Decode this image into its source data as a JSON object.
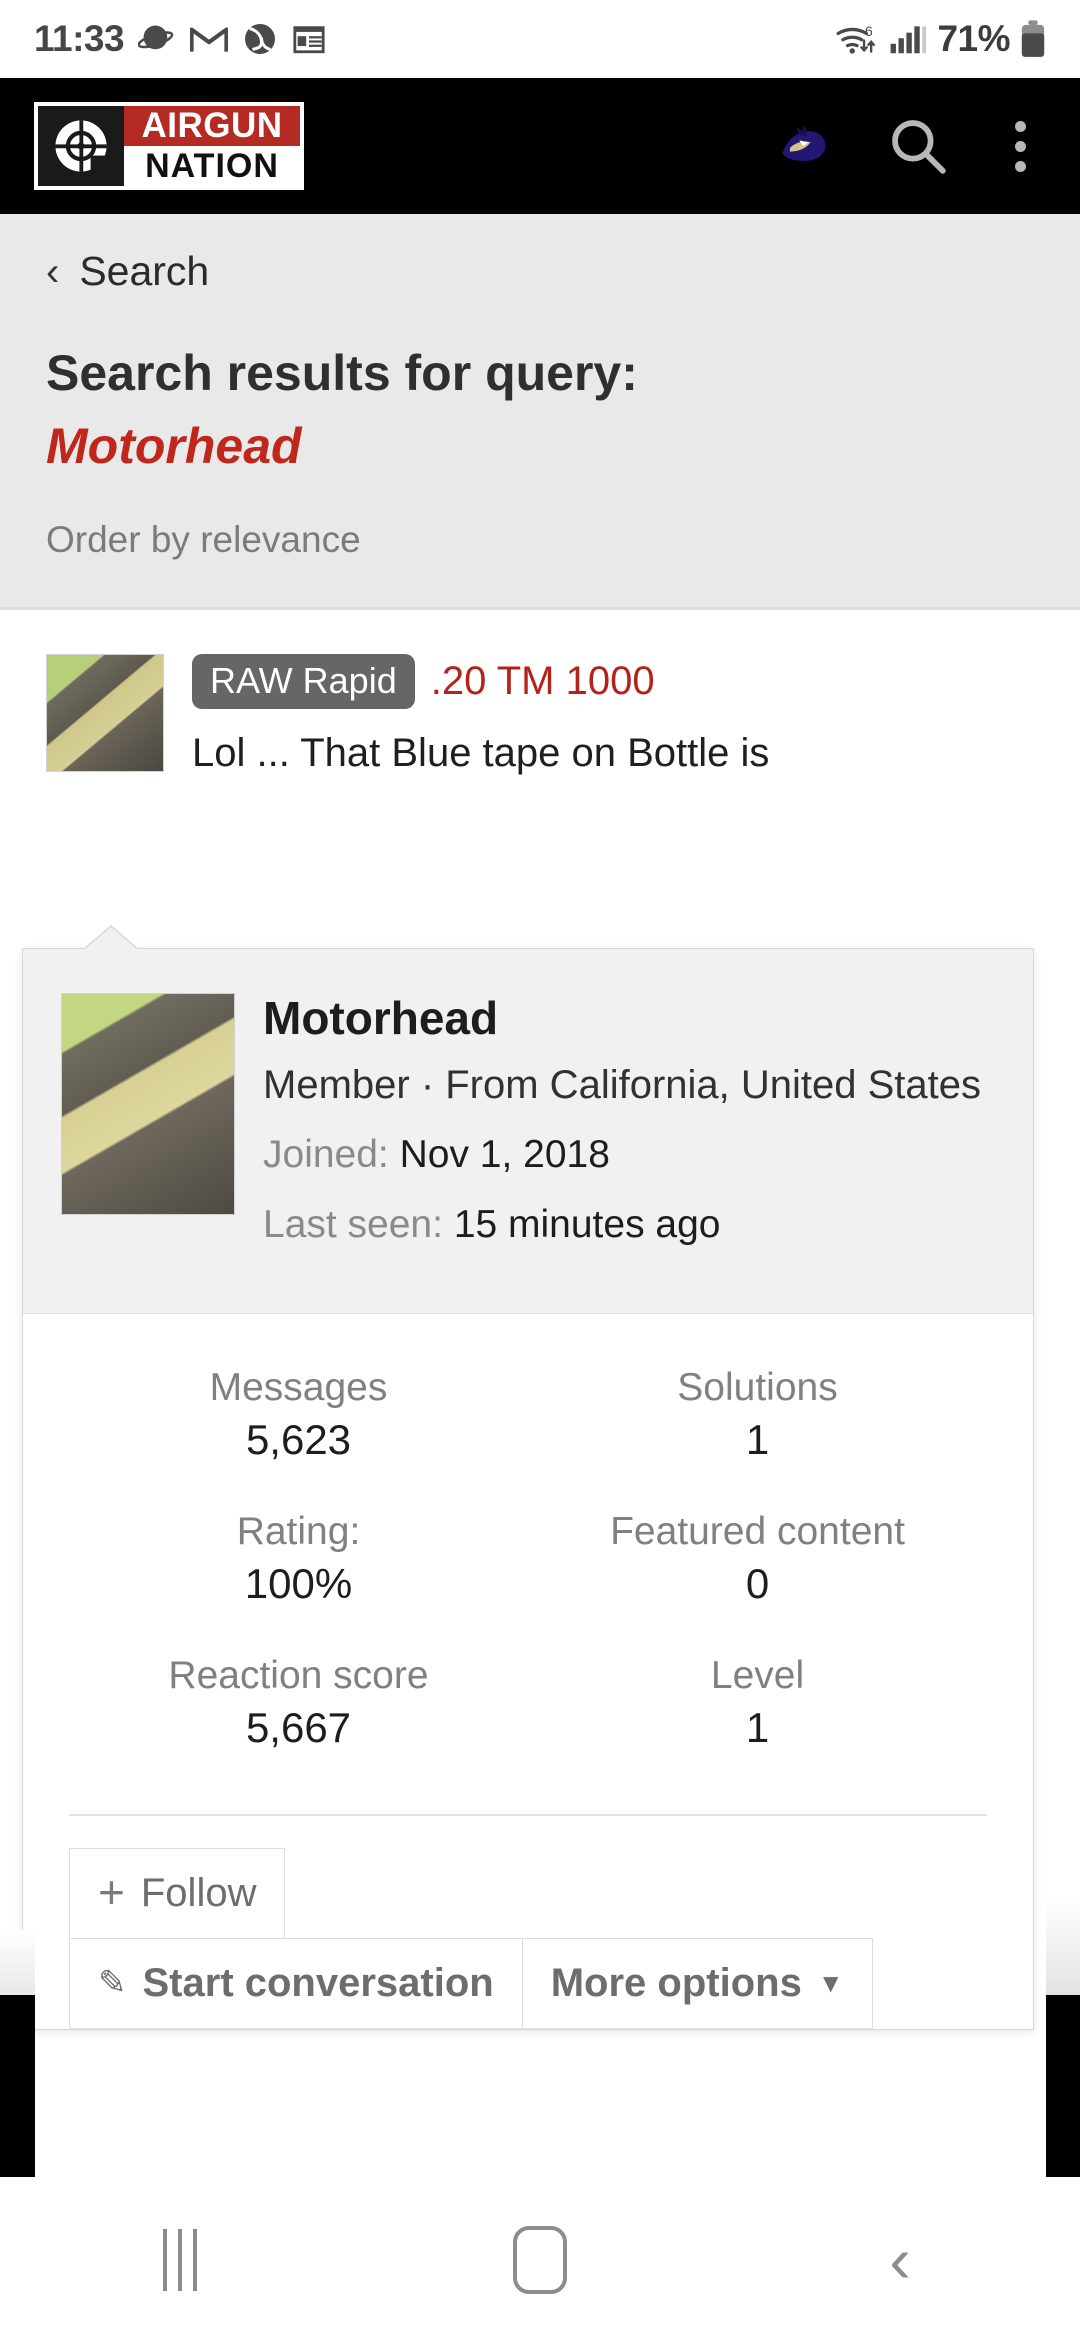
{
  "status_bar": {
    "time": "11:33",
    "left_icons": [
      "planet-icon",
      "gmail-icon",
      "baseball-icon",
      "calendar-icon"
    ],
    "wifi_label": "6",
    "signal_icon": "cellular-signal-icon",
    "battery_percent": "71%",
    "battery_icon": "battery-icon"
  },
  "site_header": {
    "logo_top": "AIRGUN",
    "logo_bottom": "NATION",
    "logo_mark": "crosshair-target-icon",
    "avatar_icon": "user-avatar-ravens-icon",
    "search_icon": "search-icon",
    "menu_icon": "kebab-menu-icon",
    "bg_color": "#000000",
    "accent_color": "#b32b23"
  },
  "search": {
    "back_chevron": "chevron-left-icon",
    "breadcrumb": "Search",
    "title": "Search results for query:",
    "query": "Motorhead",
    "order_by": "Order by relevance",
    "query_color": "#c0271c"
  },
  "result": {
    "thumbnail": "thread-author-avatar",
    "prefix_tag": "RAW Rapid",
    "title": ".20 TM 1000",
    "snippet": "Lol ... That Blue tape on Bottle is",
    "title_color": "#b3231b"
  },
  "member_card": {
    "avatar": "member-avatar",
    "username": "Motorhead",
    "role_location": "Member · From California, United States",
    "joined_label": "Joined:",
    "joined_value": "Nov 1, 2018",
    "last_seen_label": "Last seen:",
    "last_seen_value": "15 minutes ago",
    "stats": [
      {
        "label": "Messages",
        "value": "5,623"
      },
      {
        "label": "Solutions",
        "value": "1"
      },
      {
        "label": "Rating:",
        "value": "100%"
      },
      {
        "label": "Featured content",
        "value": "0"
      },
      {
        "label": "Reaction score",
        "value": "5,667"
      },
      {
        "label": "Level",
        "value": "1"
      }
    ],
    "actions": {
      "follow": "Follow",
      "follow_icon": "plus-icon",
      "start_conversation": "Start conversation",
      "start_conversation_icon": "pencil-icon",
      "more_options": "More options",
      "more_options_icon": "caret-down-icon"
    }
  },
  "nav_bar": {
    "recents": "recents-icon",
    "home": "home-icon",
    "back": "back-icon"
  }
}
